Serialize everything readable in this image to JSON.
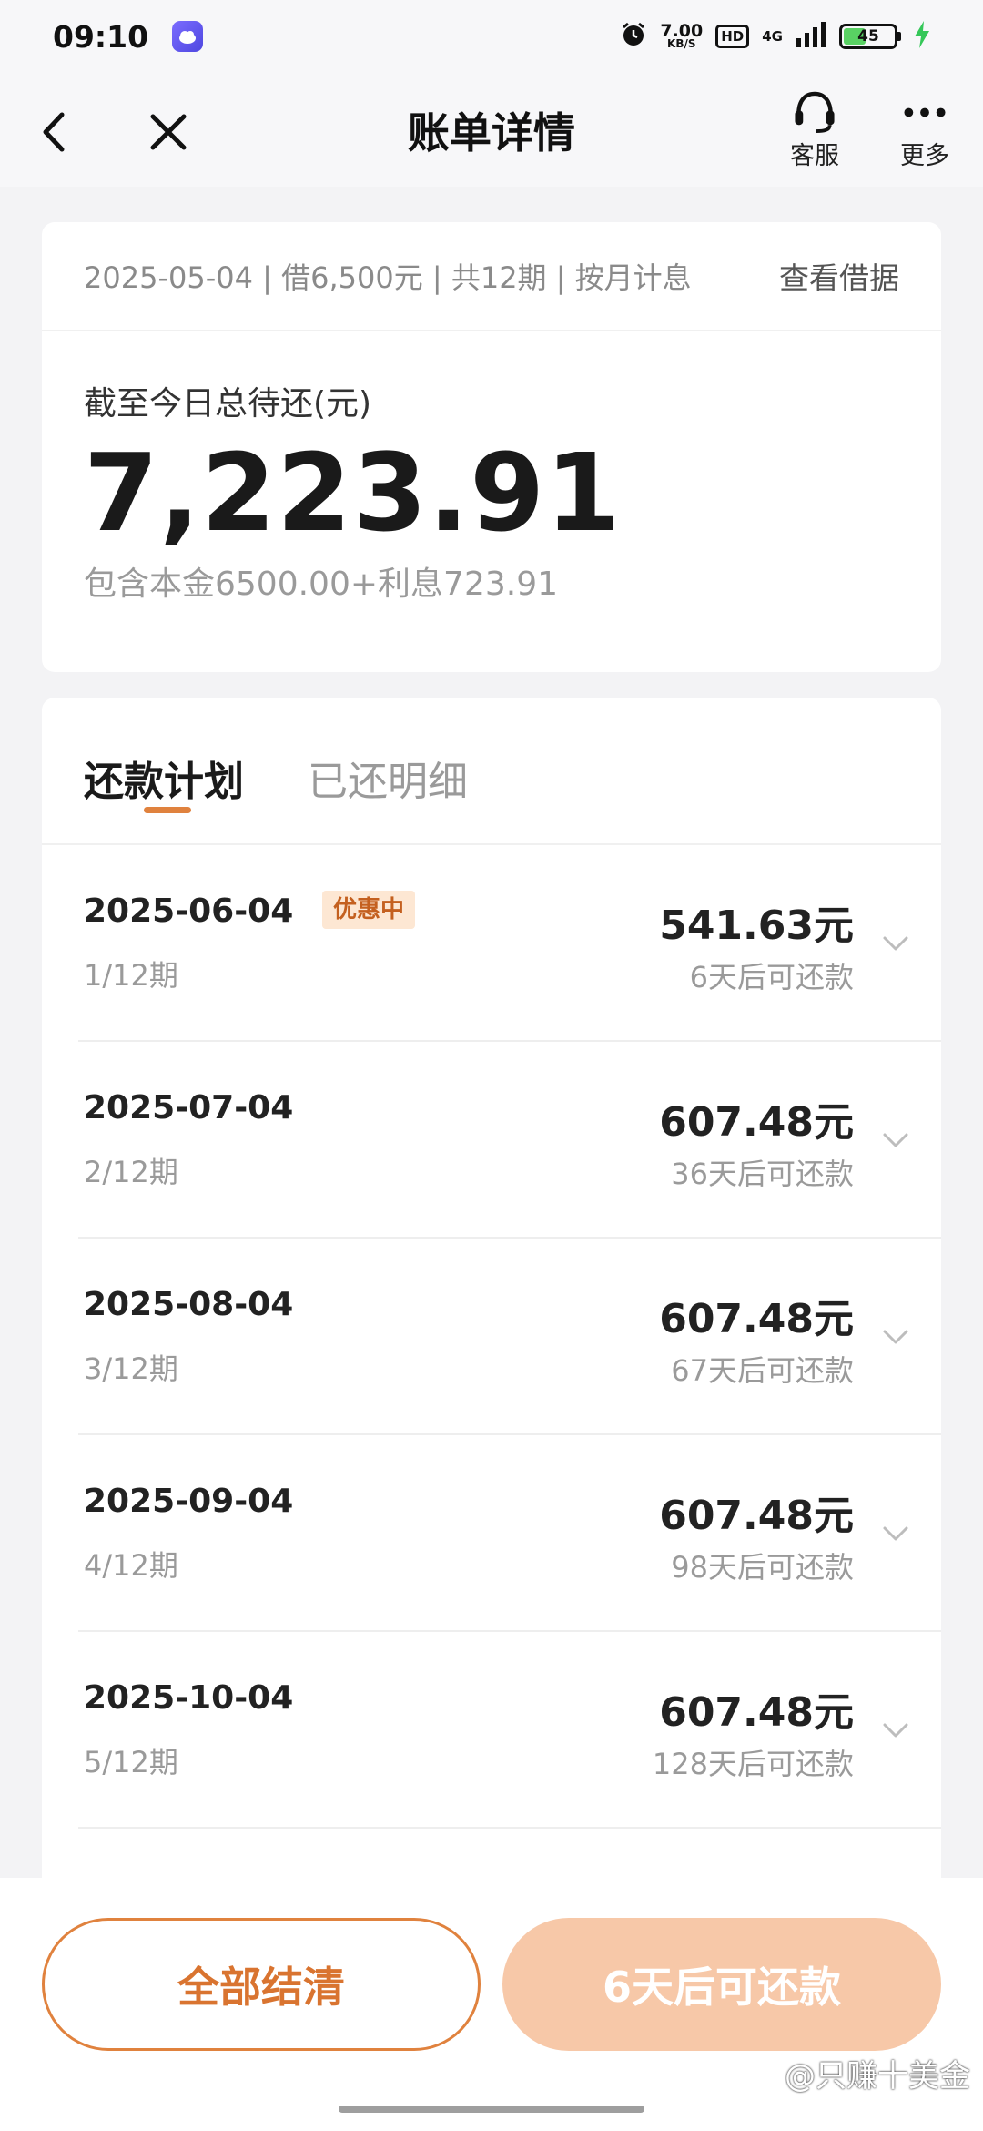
{
  "status_bar": {
    "time": "09:10",
    "net_speed_value": "7.00",
    "net_speed_unit": "KB/S",
    "hd": "HD",
    "network": "4G",
    "battery": "45"
  },
  "nav": {
    "title": "账单详情",
    "service_label": "客服",
    "more_label": "更多"
  },
  "summary": {
    "loan_info": "2025-05-04 | 借6,500元 | 共12期 | 按月计息",
    "view_contract": "查看借据",
    "due_label": "截至今日总待还(元)",
    "due_amount": "7,223.91",
    "breakdown": "包含本金6500.00+利息723.91"
  },
  "tabs": {
    "plan": "还款计划",
    "paid": "已还明细"
  },
  "schedule": [
    {
      "date": "2025-06-04",
      "badge": "优惠中",
      "period": "1/12期",
      "amount": "541.63元",
      "hint": "6天后可还款"
    },
    {
      "date": "2025-07-04",
      "period": "2/12期",
      "amount": "607.48元",
      "hint": "36天后可还款"
    },
    {
      "date": "2025-08-04",
      "period": "3/12期",
      "amount": "607.48元",
      "hint": "67天后可还款"
    },
    {
      "date": "2025-09-04",
      "period": "4/12期",
      "amount": "607.48元",
      "hint": "98天后可还款"
    },
    {
      "date": "2025-10-04",
      "period": "5/12期",
      "amount": "607.48元",
      "hint": "128天后可还款"
    }
  ],
  "bottom": {
    "settle_all": "全部结清",
    "repay": "6天后可还款",
    "watermark": "@只赚十美金"
  },
  "colors": {
    "accent": "#e0823e",
    "accent_light": "#f7c8a8",
    "badge_bg": "#fde7d3"
  }
}
